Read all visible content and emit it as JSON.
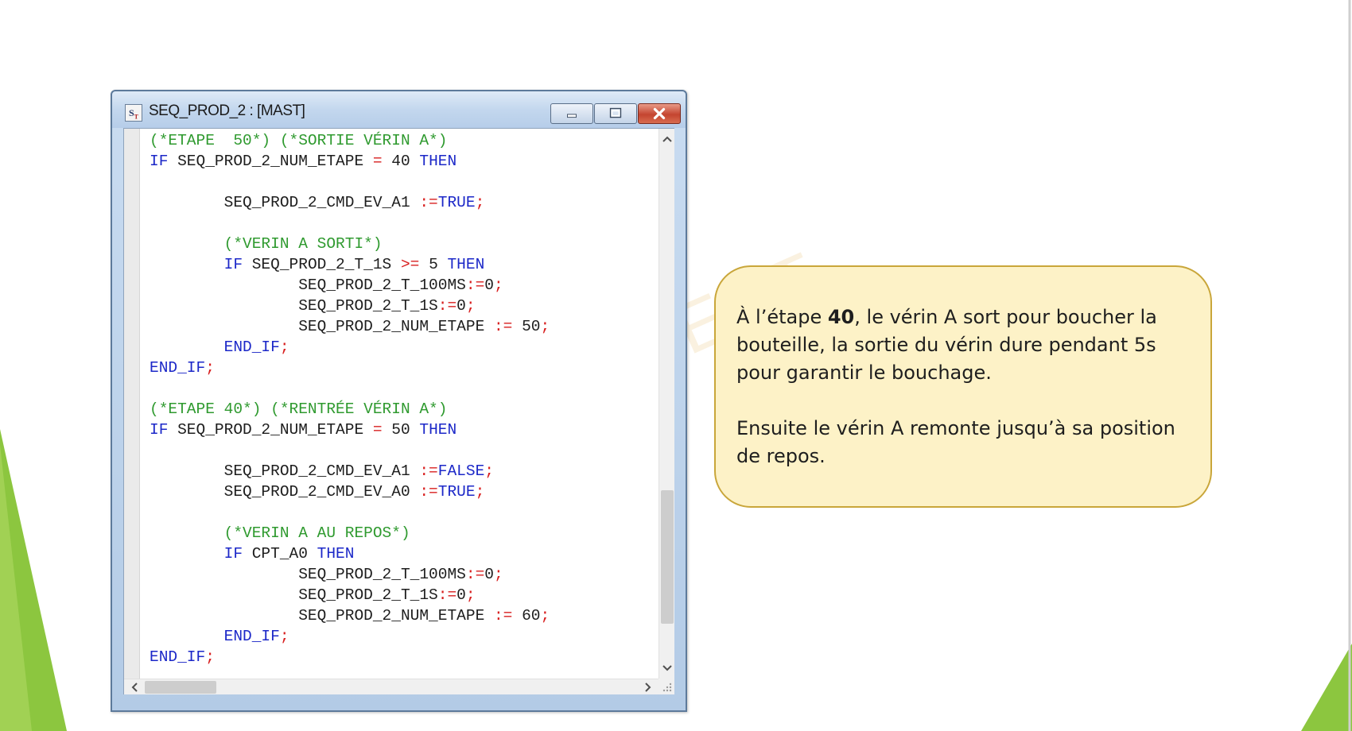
{
  "window": {
    "title": "SEQ_PROD_2 : [MAST]",
    "icon": "structured-text-icon",
    "icon_label": "S",
    "icon_sub": "T"
  },
  "code_lines": [
    [
      {
        "t": "(*ETAPE  50*) (*SORTIE VÉRIN A*)",
        "c": "cm"
      }
    ],
    [
      {
        "t": "IF",
        "c": "kw"
      },
      {
        "t": " SEQ_PROD_2_NUM_ETAPE ",
        "c": ""
      },
      {
        "t": "=",
        "c": "op"
      },
      {
        "t": " 40 ",
        "c": ""
      },
      {
        "t": "THEN",
        "c": "kw"
      }
    ],
    [],
    [
      {
        "t": "        SEQ_PROD_2_CMD_EV_A1 ",
        "c": ""
      },
      {
        "t": ":=",
        "c": "op"
      },
      {
        "t": "TRUE",
        "c": "kw"
      },
      {
        "t": ";",
        "c": "op"
      }
    ],
    [],
    [
      {
        "t": "        (*VERIN A SORTI*)",
        "c": "cm"
      }
    ],
    [
      {
        "t": "        ",
        "c": ""
      },
      {
        "t": "IF",
        "c": "kw"
      },
      {
        "t": " SEQ_PROD_2_T_1S ",
        "c": ""
      },
      {
        "t": ">=",
        "c": "op"
      },
      {
        "t": " 5 ",
        "c": ""
      },
      {
        "t": "THEN",
        "c": "kw"
      }
    ],
    [
      {
        "t": "                SEQ_PROD_2_T_100MS",
        "c": ""
      },
      {
        "t": ":=",
        "c": "op"
      },
      {
        "t": "0",
        "c": ""
      },
      {
        "t": ";",
        "c": "op"
      }
    ],
    [
      {
        "t": "                SEQ_PROD_2_T_1S",
        "c": ""
      },
      {
        "t": ":=",
        "c": "op"
      },
      {
        "t": "0",
        "c": ""
      },
      {
        "t": ";",
        "c": "op"
      }
    ],
    [
      {
        "t": "                SEQ_PROD_2_NUM_ETAPE ",
        "c": ""
      },
      {
        "t": ":=",
        "c": "op"
      },
      {
        "t": " 50",
        "c": ""
      },
      {
        "t": ";",
        "c": "op"
      }
    ],
    [
      {
        "t": "        END_IF",
        "c": "kw"
      },
      {
        "t": ";",
        "c": "op"
      }
    ],
    [
      {
        "t": "END_IF",
        "c": "kw"
      },
      {
        "t": ";",
        "c": "op"
      }
    ],
    [],
    [
      {
        "t": "(*ETAPE 40*) (*RENTRÉE VÉRIN A*)",
        "c": "cm"
      }
    ],
    [
      {
        "t": "IF",
        "c": "kw"
      },
      {
        "t": " SEQ_PROD_2_NUM_ETAPE ",
        "c": ""
      },
      {
        "t": "=",
        "c": "op"
      },
      {
        "t": " 50 ",
        "c": ""
      },
      {
        "t": "THEN",
        "c": "kw"
      }
    ],
    [],
    [
      {
        "t": "        SEQ_PROD_2_CMD_EV_A1 ",
        "c": ""
      },
      {
        "t": ":=",
        "c": "op"
      },
      {
        "t": "FALSE",
        "c": "kw"
      },
      {
        "t": ";",
        "c": "op"
      }
    ],
    [
      {
        "t": "        SEQ_PROD_2_CMD_EV_A0 ",
        "c": ""
      },
      {
        "t": ":=",
        "c": "op"
      },
      {
        "t": "TRUE",
        "c": "kw"
      },
      {
        "t": ";",
        "c": "op"
      }
    ],
    [],
    [
      {
        "t": "        (*VERIN A AU REPOS*)",
        "c": "cm"
      }
    ],
    [
      {
        "t": "        ",
        "c": ""
      },
      {
        "t": "IF",
        "c": "kw"
      },
      {
        "t": " CPT_A0 ",
        "c": ""
      },
      {
        "t": "THEN",
        "c": "kw"
      }
    ],
    [
      {
        "t": "                SEQ_PROD_2_T_100MS",
        "c": ""
      },
      {
        "t": ":=",
        "c": "op"
      },
      {
        "t": "0",
        "c": ""
      },
      {
        "t": ";",
        "c": "op"
      }
    ],
    [
      {
        "t": "                SEQ_PROD_2_T_1S",
        "c": ""
      },
      {
        "t": ":=",
        "c": "op"
      },
      {
        "t": "0",
        "c": ""
      },
      {
        "t": ";",
        "c": "op"
      }
    ],
    [
      {
        "t": "                SEQ_PROD_2_NUM_ETAPE ",
        "c": ""
      },
      {
        "t": ":=",
        "c": "op"
      },
      {
        "t": " 60",
        "c": ""
      },
      {
        "t": ";",
        "c": "op"
      }
    ],
    [
      {
        "t": "        END_IF",
        "c": "kw"
      },
      {
        "t": ";",
        "c": "op"
      }
    ],
    [
      {
        "t": "END_IF",
        "c": "kw"
      },
      {
        "t": ";",
        "c": "op"
      }
    ]
  ],
  "callout": {
    "p1_before": "À l’étape ",
    "p1_bold": "40",
    "p1_after": ", le vérin A sort pour boucher la bouteille, la sortie du vérin dure pendant 5s pour garantir le bouchage.",
    "p2": "Ensuite le vérin A remonte jusqu’à sa position de repos."
  },
  "colors": {
    "comment": "#2f9a2f",
    "keyword": "#1c28c8",
    "operator": "#d81e1e",
    "callout_fill": "#fdf2c7",
    "callout_border": "#c9a63a",
    "accent_green": "#8cc63f"
  }
}
